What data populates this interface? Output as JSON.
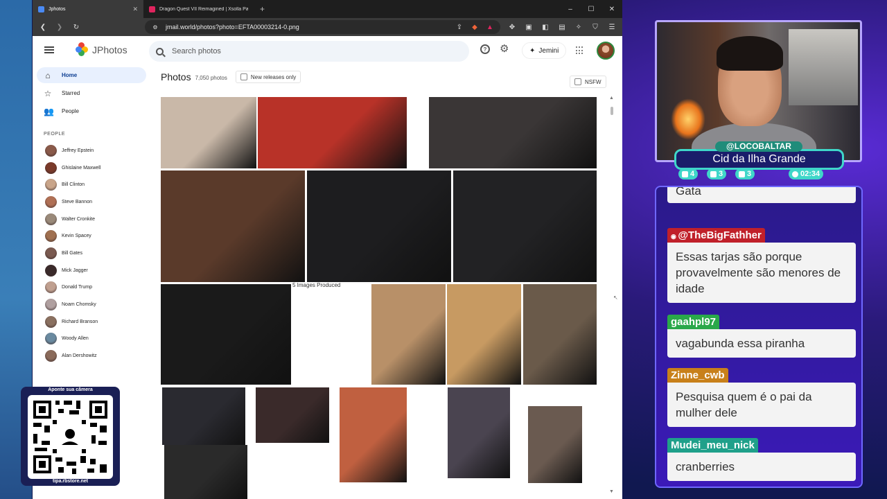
{
  "browser": {
    "tabs": [
      {
        "title": "Jphotos",
        "active": true,
        "favicon_color": "#4a8af4"
      },
      {
        "title": "Dragon Quest VII Reimagined | Xsolla Partne",
        "active": false,
        "favicon_color": "#e0245e"
      }
    ],
    "new_tab": "+",
    "window_controls": [
      "–",
      "☐",
      "✕"
    ],
    "url": "jmail.world/photos?photo=EFTA00003214-0.png"
  },
  "app": {
    "name": "JPhotos",
    "search_placeholder": "Search photos",
    "jemini_label": "Jemini",
    "help_icon": "?"
  },
  "sidebar": {
    "nav": [
      {
        "label": "Home",
        "icon": "home-icon",
        "active": true
      },
      {
        "label": "Starred",
        "icon": "star-icon",
        "active": false
      },
      {
        "label": "People",
        "icon": "people-icon",
        "active": false
      }
    ],
    "people_header": "PEOPLE",
    "people": [
      {
        "name": "Jeffrey Epstein",
        "color": "#8a5a4a"
      },
      {
        "name": "Ghislaine Maxwell",
        "color": "#7a3a2a"
      },
      {
        "name": "Bill Clinton",
        "color": "#c9a58a"
      },
      {
        "name": "Steve Bannon",
        "color": "#b07055"
      },
      {
        "name": "Walter Cronkite",
        "color": "#9a8a7a"
      },
      {
        "name": "Kevin Spacey",
        "color": "#a07050"
      },
      {
        "name": "Bill Gates",
        "color": "#7a5a50"
      },
      {
        "name": "Mick Jagger",
        "color": "#3a2a2a"
      },
      {
        "name": "Donald Trump",
        "color": "#c0a090"
      },
      {
        "name": "Noam Chomsky",
        "color": "#b0a0a0"
      },
      {
        "name": "Richard Branson",
        "color": "#8a7060"
      },
      {
        "name": "Woody Allen",
        "color": "#6a8aa0"
      },
      {
        "name": "Alan Dershowitz",
        "color": "#8a6a5a"
      }
    ]
  },
  "photos": {
    "title": "Photos",
    "count": "7,050 photos",
    "new_releases_label": "New releases only",
    "nsfw_label": "NSFW",
    "partial_caption": "5 Images Produced",
    "tiles": [
      {
        "color": "#c9b8a8"
      },
      {
        "color": "#b83228"
      },
      {
        "color": "#3a3636"
      },
      {
        "color": "#5a3a2a"
      },
      {
        "color": "#1d1d1f"
      },
      {
        "color": "#222224"
      },
      {
        "color": "#1a1a1a"
      },
      {
        "color": "#ffffff"
      },
      {
        "color": "#b89068"
      },
      {
        "color": "#c79a62"
      },
      {
        "color": "#6a5a4a"
      },
      {
        "color": "#2a2a30"
      },
      {
        "color": "#3a2a2a"
      },
      {
        "color": "#c06040"
      },
      {
        "color": "#4a4450"
      },
      {
        "color": "#6a5a50"
      },
      {
        "color": "#2a2a2a"
      }
    ]
  },
  "qr": {
    "top_text": "Aponte sua câmera",
    "bottom_text": "tipa.rbstore.net"
  },
  "stream": {
    "handle": "@LOCOBALTAR",
    "location": "Cid da Ilha Grande",
    "stats": [
      {
        "icon": "chat-icon",
        "value": "4"
      },
      {
        "icon": "youtube-icon",
        "value": "3"
      },
      {
        "icon": "twitch-icon",
        "value": "3"
      },
      {
        "icon": "clock-icon",
        "value": "02:34"
      }
    ]
  },
  "chat": {
    "messages": [
      {
        "user": "",
        "text": "Gata",
        "user_color": "#7a2a8a"
      },
      {
        "user": "@TheBigFathher",
        "text": "Essas tarjas são porque provavelmente são menores de idade",
        "user_color": "#c0202a"
      },
      {
        "user": "gaahpl97",
        "text": "vagabunda essa piranha",
        "user_color": "#2aa84a"
      },
      {
        "user": "Zinne_cwb",
        "text": "Pesquisa quem é o pai da mulher dele",
        "user_color": "#c8801a"
      },
      {
        "user": "Mudei_meu_nick",
        "text": "cranberries",
        "user_color": "#1fa08a"
      }
    ]
  }
}
